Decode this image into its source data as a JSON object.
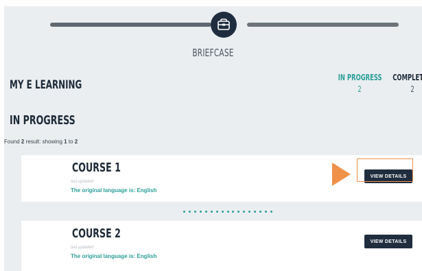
{
  "header": {
    "section_label": "BRIEFCASE",
    "icon": "briefcase-icon"
  },
  "main": {
    "title": "MY E LEARNING",
    "stats": {
      "in_progress": {
        "label": "IN PROGRESS",
        "count": "2"
      },
      "completed": {
        "label": "COMPLETED",
        "count": "2"
      }
    },
    "section_title": "IN PROGRESS",
    "results": {
      "prefix": "Found ",
      "found": "2",
      "middle": " result: showing ",
      "from": "1",
      "to_word": " to ",
      "to": "2"
    },
    "courses": [
      {
        "title": "COURSE 1",
        "last_updated": "last updated:",
        "language": "The original language is: English",
        "button": "VIEW DETAILS"
      },
      {
        "title": "COURSE 2",
        "last_updated": "last updated:",
        "language": "The original language is: English",
        "button": "VIEW DETAILS"
      }
    ]
  },
  "colors": {
    "accent_teal": "#2a9e98",
    "navy": "#1f2d3f",
    "highlight_orange": "#ef9149",
    "background": "#ebeef1"
  }
}
